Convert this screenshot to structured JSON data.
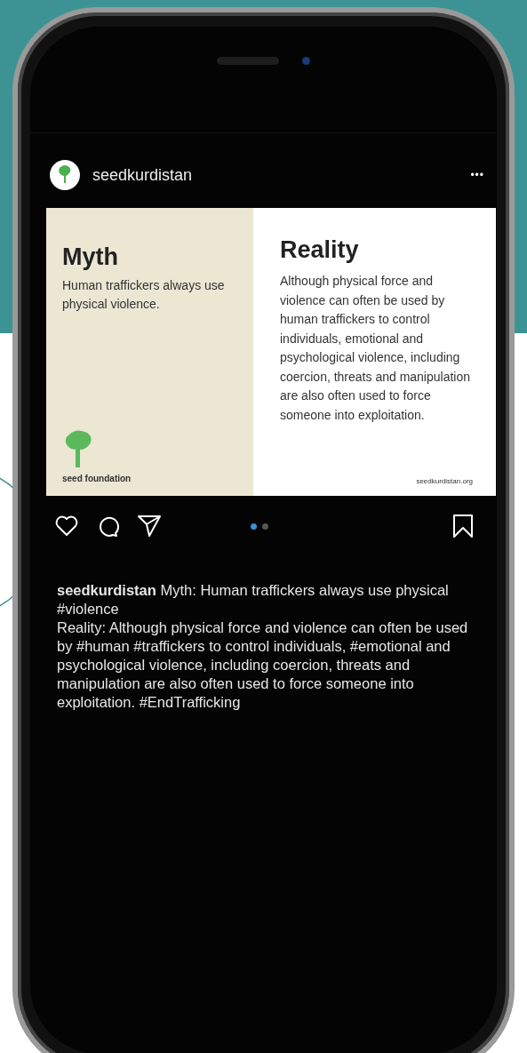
{
  "post": {
    "username": "seedkurdistan",
    "menu": "•••",
    "image": {
      "myth_title": "Myth",
      "myth_text": "Human traffickers always use physical violence.",
      "logo_text": "seed foundation",
      "reality_title": "Reality",
      "reality_text": "Although physical force and violence can often be used by human traffickers to control individuals, emotional and psychological violence, including coercion, threats and manipulation are also often used to force someone into exploitation.",
      "website": "seedkurdistan.org"
    },
    "carousel": [
      {
        "selected": true
      },
      {
        "selected": false
      }
    ],
    "caption": [
      "**seedkurdistan** Myth: Human traffickers always use physical #violence",
      "Reality: Although physical force and violence can often be used by #human #traffickers to control individuals, #emotional and psychological violence, including coercion, threats and manipulation are also often used to force someone into exploitation. #EndTrafficking"
    ]
  }
}
